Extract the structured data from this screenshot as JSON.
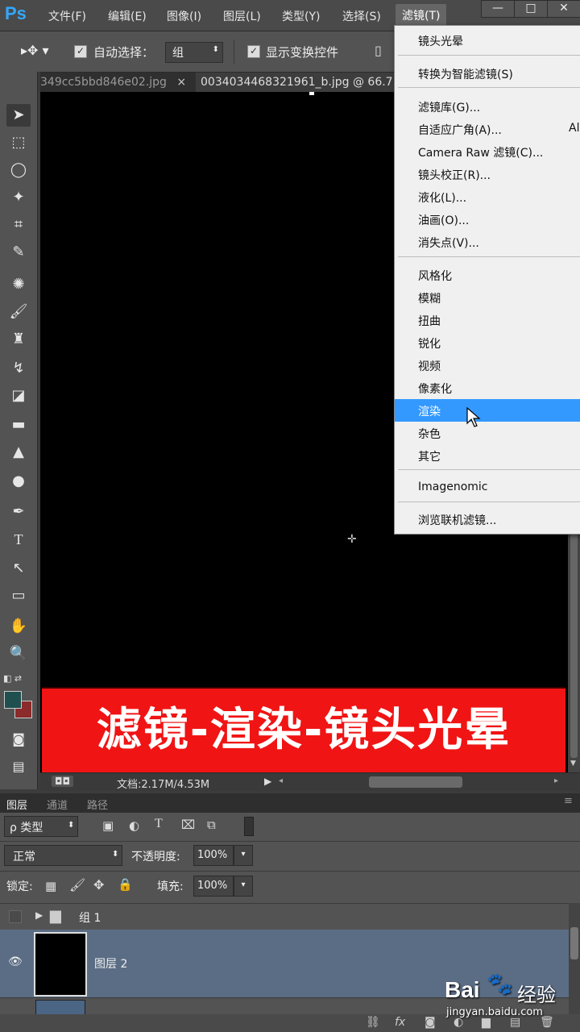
{
  "app": {
    "logo": "Ps"
  },
  "menubar": {
    "items": [
      "文件(F)",
      "编辑(E)",
      "图像(I)",
      "图层(L)",
      "类型(Y)",
      "选择(S)",
      "滤镜(T)"
    ],
    "window_buttons": [
      "—",
      "□",
      "✕"
    ]
  },
  "options": {
    "auto_select_label": "自动选择：",
    "auto_select_value": "组",
    "show_transform_label": "显示变换控件"
  },
  "tabs": [
    "349cc5bbd846e02.jpg",
    "0034034468321961_b.jpg @ 66.7"
  ],
  "filter_menu": {
    "group1": [
      "镜头光晕"
    ],
    "group2": [
      "转换为智能滤镜(S)"
    ],
    "group3": [
      "滤镜库(G)...",
      "自适应广角(A)...",
      "Camera Raw 滤镜(C)...",
      "镜头校正(R)...",
      "液化(L)...",
      "油画(O)...",
      "消失点(V)..."
    ],
    "group3_shortcut": "Al",
    "group4": [
      "风格化",
      "模糊",
      "扭曲",
      "锐化",
      "视频",
      "像素化",
      "渲染",
      "杂色",
      "其它"
    ],
    "group5": [
      "Imagenomic"
    ],
    "group6": [
      "浏览联机滤镜..."
    ],
    "highlighted": "渲染"
  },
  "banner": {
    "text": "滤镜-渲染-镜头光晕"
  },
  "status": {
    "doc_info": "文档:2.17M/4.53M"
  },
  "layers": {
    "tabs": [
      "图层",
      "通道",
      "路径"
    ],
    "filter_kind": "ρ 类型",
    "blend_mode": "正常",
    "opacity_label": "不透明度:",
    "opacity_value": "100%",
    "lock_label": "锁定:",
    "fill_label": "填充:",
    "fill_value": "100%",
    "items": [
      {
        "name": "组 1",
        "type": "group"
      },
      {
        "name": "图层 2",
        "type": "layer",
        "selected": true
      }
    ]
  },
  "watermark": {
    "brand": "Bai",
    "brand2": "经验",
    "url": "jingyan.baidu.com"
  },
  "colors": {
    "highlight": "#3399ff",
    "banner": "#f01414",
    "selected_layer": "#5b6d85"
  }
}
